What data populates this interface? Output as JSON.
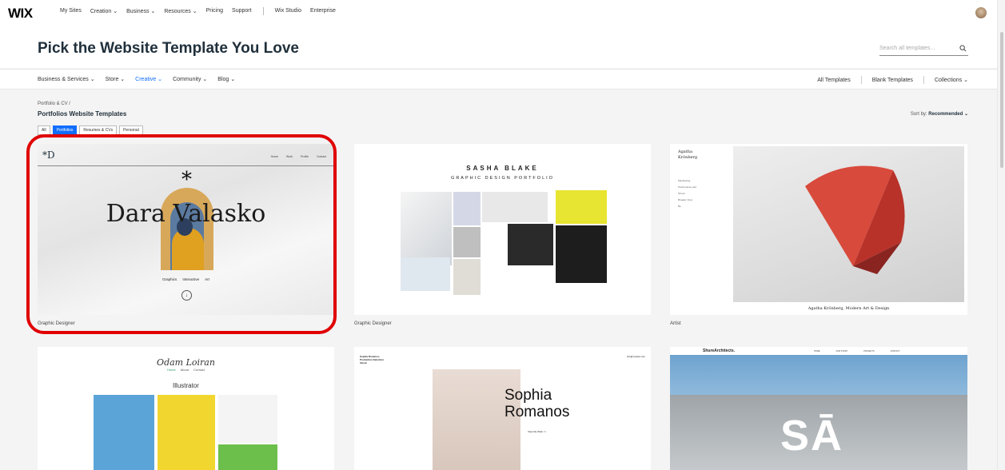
{
  "topnav": {
    "logo": "WIX",
    "links": [
      "My Sites",
      "Creation ⌄",
      "Business ⌄",
      "Resources ⌄",
      "Pricing",
      "Support"
    ],
    "links2": [
      "Wix Studio",
      "Enterprise"
    ]
  },
  "header": {
    "title": "Pick the Website Template You Love",
    "search_placeholder": "Search all templates..."
  },
  "categories": {
    "items": [
      "Business & Services ⌄",
      "Store ⌄",
      "Creative ⌄",
      "Community ⌄",
      "Blog ⌄"
    ],
    "active_index": 2,
    "right_links": [
      "All Templates",
      "Blank Templates",
      "Collections ⌄"
    ]
  },
  "listing": {
    "breadcrumb": "Portfolio & CV /",
    "title": "Portfolios Website Templates",
    "sort_label": "Sort by:",
    "sort_value": "Recommended ⌄",
    "filters": [
      "All",
      "Portfolios",
      "Resumes & CVs",
      "Personal"
    ],
    "active_filter": 1
  },
  "cards": [
    {
      "label": "Graphic Designer",
      "preview": {
        "mark": "*D",
        "menu": [
          "Home",
          "Work",
          "Profile",
          "Contact"
        ],
        "star": "*",
        "name": "Dara Valasko",
        "tags": "Graphics Interactive Art",
        "down_arrow": "↓"
      }
    },
    {
      "label": "Graphic Designer",
      "preview": {
        "title": "SASHA BLAKE",
        "subtitle": "GRAPHIC DESIGN PORTFOLIO"
      }
    },
    {
      "label": "Artist",
      "preview": {
        "name_line1": "Agatha",
        "name_line2": "Krönberg",
        "menu": [
          "Manifesting",
          "Performance part",
          "Ob'ekt",
          "Broader View",
          "Be"
        ],
        "caption": "Agatha Krönberg, Modern Art & Design"
      }
    },
    {
      "label": "",
      "preview": {
        "name": "Odam Loiran",
        "nav_active": "Home",
        "nav": [
          "About",
          "Contact"
        ],
        "heading": "Illustrator"
      }
    },
    {
      "label": "",
      "preview": {
        "top_left": [
          "Sophia Romanos",
          "Production Selection",
          "About"
        ],
        "top_right": "info@mysite.com",
        "name_line1": "Sophia",
        "name_line2": "Romanos",
        "cta": "View My Work >>"
      }
    },
    {
      "label": "",
      "preview": {
        "brand": "ShureArchitects.",
        "menu": [
          "HOME",
          "OUR STORY",
          "PROJECTS",
          "CONTACT"
        ],
        "big_text": "SĀ"
      }
    }
  ],
  "colors": {
    "accent": "#116dff",
    "highlight": "#e00000"
  }
}
